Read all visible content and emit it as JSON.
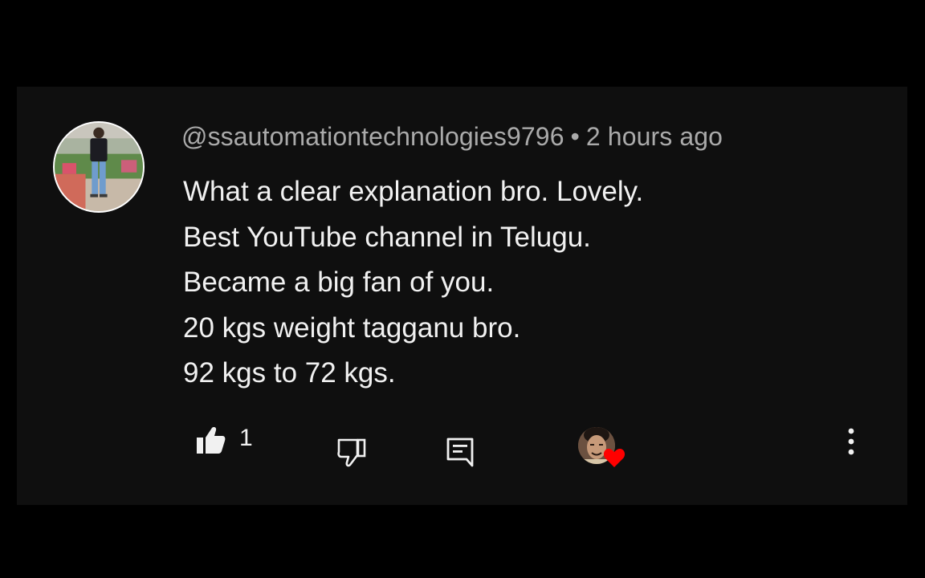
{
  "comment": {
    "handle": "@ssautomationtechnologies9796",
    "separator": "•",
    "timestamp": "2 hours ago",
    "lines": [
      "What a clear explanation bro. Lovely.",
      "Best YouTube channel in Telugu.",
      "Became a big fan of you.",
      "20 kgs weight tagganu bro.",
      "92 kgs to 72 kgs."
    ]
  },
  "actions": {
    "like_count": "1",
    "icons": {
      "like": "thumbs-up-icon",
      "dislike": "thumbs-down-icon",
      "reply": "reply-comment-icon",
      "creator_heart": "heart-icon",
      "more": "more-vertical-icon"
    }
  },
  "colors": {
    "background": "#000000",
    "card": "#0f0f0f",
    "text_primary": "#f1f1f1",
    "text_secondary": "#aaaaaa",
    "heart": "#ff0000"
  }
}
